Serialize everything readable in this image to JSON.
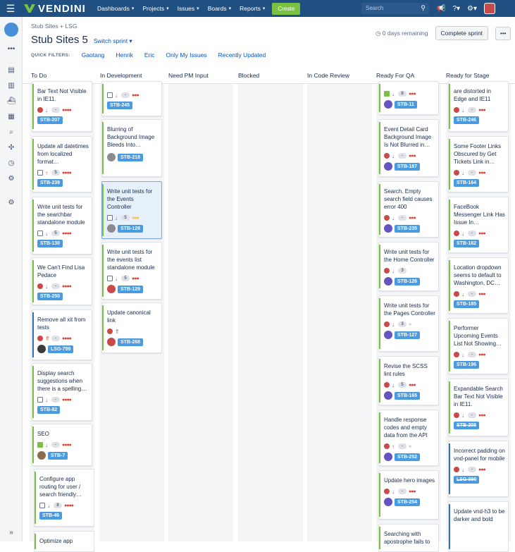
{
  "topbar": {
    "brand": "VENDINI",
    "nav": [
      "Dashboards",
      "Projects",
      "Issues",
      "Boards",
      "Reports"
    ],
    "create": "Create",
    "search_placeholder": "Search"
  },
  "header": {
    "breadcrumb": "Stub Sites + LSG",
    "title": "Stub Sites 5",
    "switch": "Switch sprint ▾",
    "remaining": "0 days remaining",
    "complete": "Complete sprint",
    "more": "•••"
  },
  "quick_filters": {
    "label": "QUICK FILTERS:",
    "items": [
      "Gaotang",
      "Henrik",
      "Eric",
      "Only My Issues",
      "Recently Updated"
    ]
  },
  "columns": [
    "To Do",
    "In Development",
    "Need PM Input",
    "Blocked",
    "In Code Review",
    "Ready For QA",
    "Ready for Stage"
  ],
  "cards": {
    "todo": [
      {
        "title": "Bar Text Not Visible in IE11.",
        "key": "STB-207"
      },
      {
        "title": "Update all datetimes from localized format…",
        "key": "STB-239",
        "est": "5"
      },
      {
        "title": "Write unit tests for the searchbar standalone module",
        "key": "STB-130",
        "est": "5"
      },
      {
        "title": "We Can't Find Lisa Pedace",
        "key": "STB-250"
      },
      {
        "title": "Remove all xit from tests",
        "key": "LSG-799"
      },
      {
        "title": "Display search suggestions when there is a spelling…",
        "key": "STB-82"
      },
      {
        "title": "SEO",
        "key": "STB-7"
      },
      {
        "title": "Configure app routing for user / search friendly…",
        "key": "STB-46",
        "est": "8"
      },
      {
        "title": "Optimize app"
      }
    ],
    "indev": [
      {
        "key": "STB-245"
      },
      {
        "title": "Blurring of Background Image Bleeds Into…",
        "key": "STB-218"
      },
      {
        "title": "Write unit tests for the Events Controller",
        "key": "STB-128",
        "est": "5"
      },
      {
        "title": "Write unit tests for the events list standalone module",
        "key": "STB-129",
        "est": "5"
      },
      {
        "title": "Update canonical link",
        "key": "STB-268"
      }
    ],
    "qa": [
      {
        "key": "STB-11",
        "est": "8"
      },
      {
        "title": "Event Detail Card Background Image Is Not Blurred in…",
        "key": "STB-187"
      },
      {
        "title": "Search. Empty search field causes error 400",
        "key": "STB-235"
      },
      {
        "title": "Write unit tests for the Home Controller",
        "key": "STB-126",
        "est": "3"
      },
      {
        "title": "Write unit tests for the Pages Controller",
        "key": "STB-127",
        "est": "3"
      },
      {
        "title": "Revise the SCSS lint rules",
        "key": "STB-165",
        "est": "5"
      },
      {
        "title": "Handle response codes and empty data from the API",
        "key": "STB-252"
      },
      {
        "title": "Update hero images",
        "key": "STB-254"
      },
      {
        "title": "Searching with apostrophe fails to"
      }
    ],
    "stage": [
      {
        "title": "are distorted in Edge and IE11",
        "key": "STB-246"
      },
      {
        "title": "Some Footer Links Obscured by Get Tickets Link in…",
        "key": "STB-164"
      },
      {
        "title": "FaceBook Messenger Link Has Issue In…",
        "key": "STB-182"
      },
      {
        "title": "Location dropdown seems to default to Washington, DC…",
        "key": "STB-185"
      },
      {
        "title": "Performer Upcoming Events List Not Showing…",
        "key": "STB-196"
      },
      {
        "title": "Expandable Search Bar Text Not Visible in IE11.",
        "key": "STB-208"
      },
      {
        "title": "Incorrect padding on vnd-panel for mobile",
        "key": "LSG-990"
      },
      {
        "title": "Update vnd-h3 to be darker and bold"
      }
    ]
  },
  "dash": "-"
}
